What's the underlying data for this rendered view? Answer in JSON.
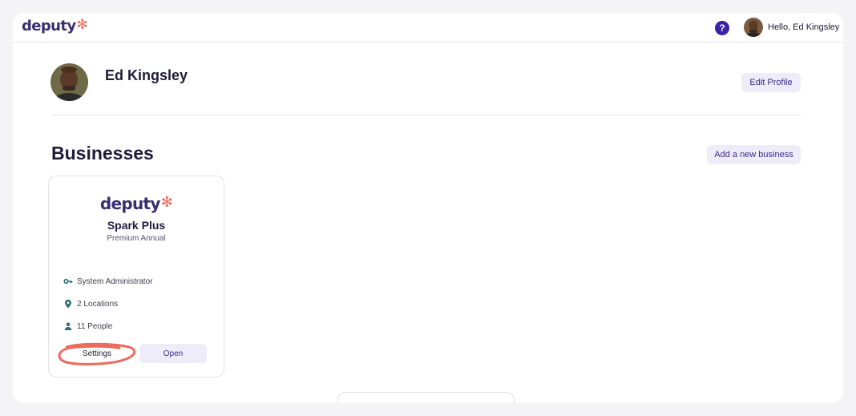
{
  "brand": {
    "name": "deputy",
    "star": "✻",
    "color": "#3a2e73",
    "accent": "#ee6a5c"
  },
  "topbar": {
    "help_icon": "question-icon",
    "help_text": "?",
    "greeting": "Hello, Ed Kingsley"
  },
  "profile": {
    "name": "Ed Kingsley",
    "edit_label": "Edit Profile"
  },
  "businesses": {
    "title": "Businesses",
    "add_label": "Add a new business",
    "cards": [
      {
        "logo": "deputy",
        "name": "Spark Plus",
        "plan": "Premium Annual",
        "role": "System Administrator",
        "locations": "2 Locations",
        "people": "11 People",
        "settings_label": "Settings",
        "open_label": "Open",
        "annotation_color": "#ee6a5c"
      }
    ]
  }
}
